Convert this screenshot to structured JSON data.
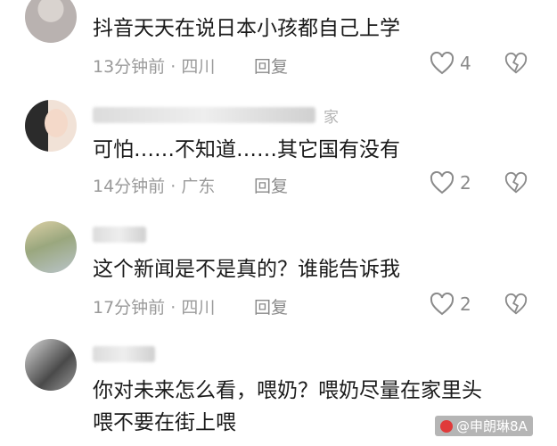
{
  "comments": [
    {
      "text": "抖音天天在说日本小孩都自己上学",
      "time": "13分钟前",
      "location": "四川",
      "reply": "回复",
      "likes": "4"
    },
    {
      "username_tail": "家",
      "text": "可怕……不知道……其它国有没有",
      "time": "14分钟前",
      "location": "广东",
      "reply": "回复",
      "likes": "2"
    },
    {
      "text": "这个新闻是不是真的？谁能告诉我",
      "time": "17分钟前",
      "location": "四川",
      "reply": "回复",
      "likes": "2"
    },
    {
      "text_line1": "你对未来怎么看，喂奶？喂奶尽量在家里头",
      "text_line2": "喂不要在街上喂"
    }
  ],
  "meta_sep": " · ",
  "watermark": "@申朗琳8A",
  "icons": {
    "like": "heart-icon",
    "dislike": "broken-heart-icon"
  }
}
